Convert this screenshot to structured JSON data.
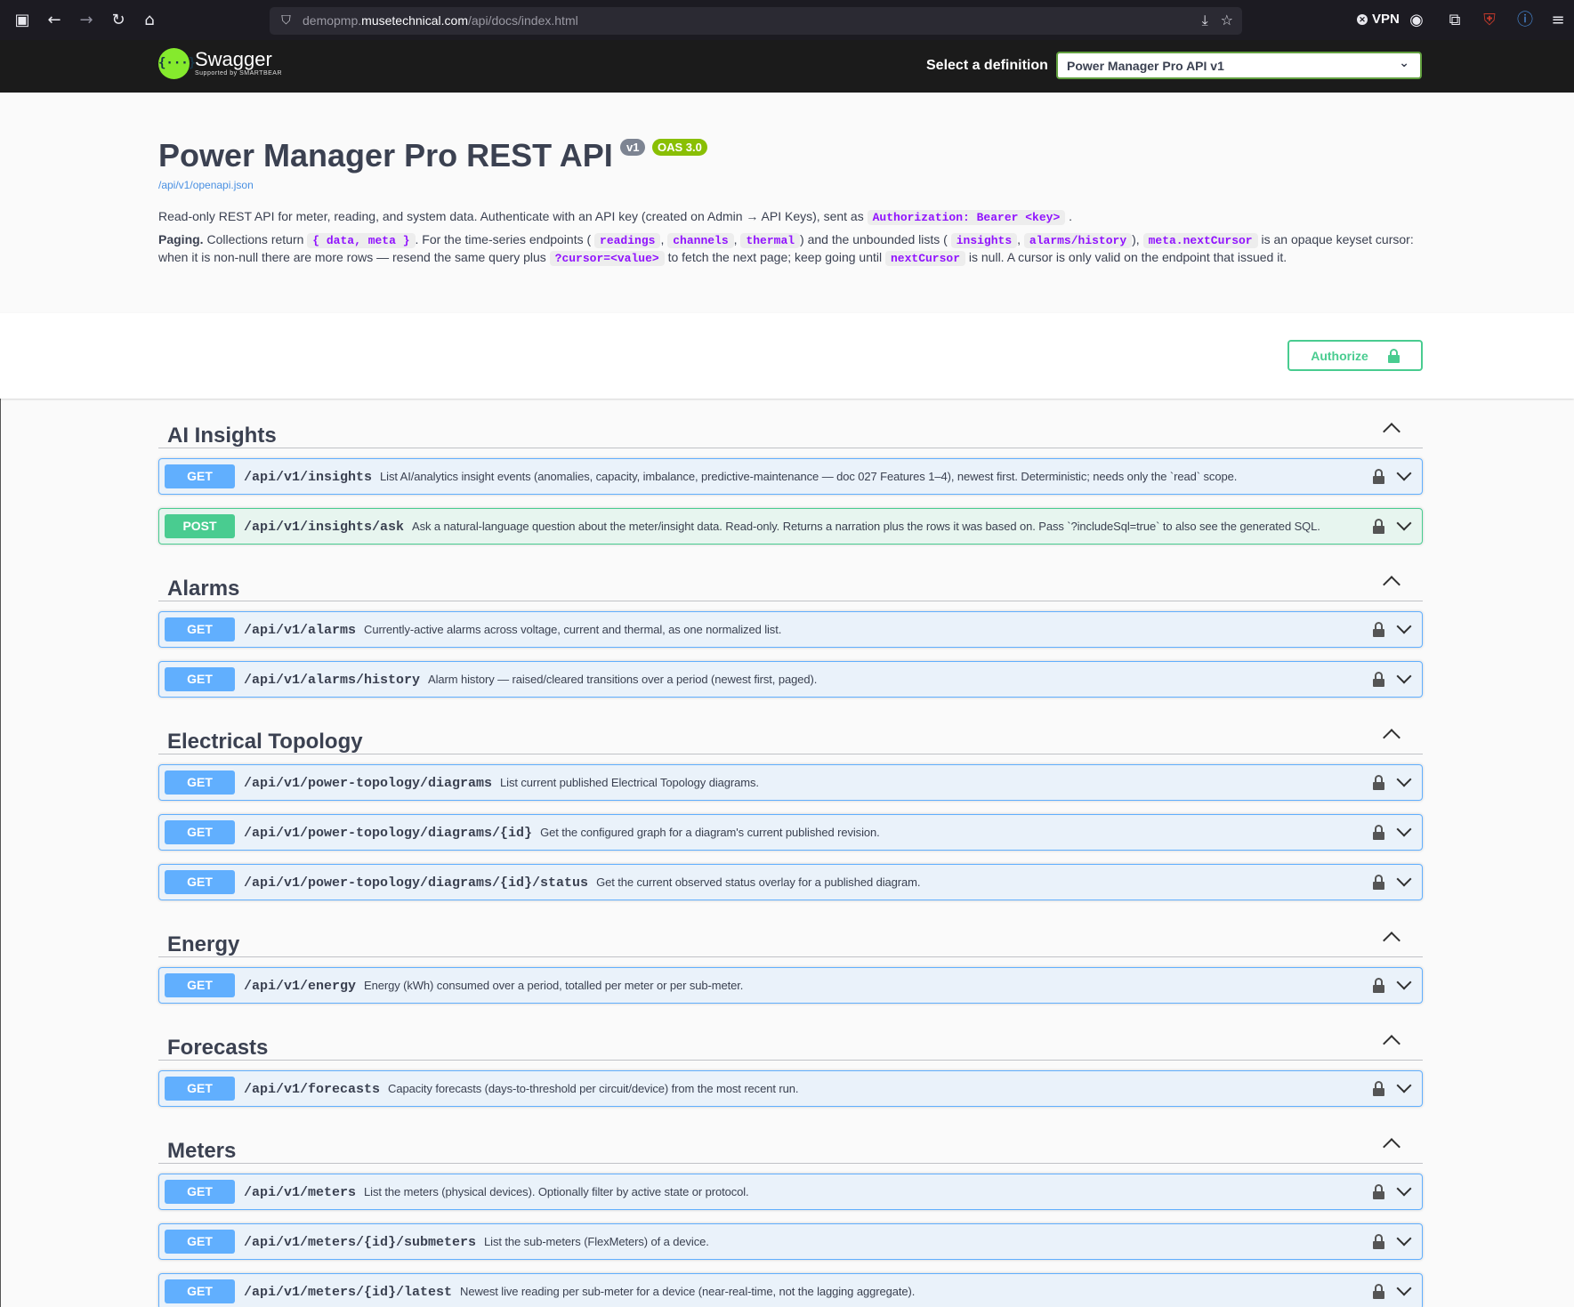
{
  "browser": {
    "url_prefix": "demopmp.",
    "url_host": "musetechnical.com",
    "url_path": "/api/docs/index.html",
    "vpn_label": "VPN"
  },
  "topbar": {
    "logo_main": "Swagger",
    "logo_sub": "Supported by SMARTBEAR",
    "definition_label": "Select a definition",
    "definition_value": "Power Manager Pro API v1"
  },
  "info": {
    "title": "Power Manager Pro REST API",
    "version_badge": "v1",
    "oas_badge": "OAS 3.0",
    "spec_link": "/api/v1/openapi.json",
    "p1_text": "Read-only REST API for meter, reading, and system data. Authenticate with an API key (created on Admin → API Keys), sent as",
    "p1_code": "Authorization: Bearer <key>",
    "p1_end": ".",
    "p2_bold": "Paging.",
    "p2_a": " Collections return",
    "p2_code1": "{ data, meta }",
    "p2_b": ". For the time-series endpoints (",
    "p2_code2": "readings",
    "p2_c": ",",
    "p2_code3": "channels",
    "p2_d": ",",
    "p2_code4": "thermal",
    "p2_e": ") and the unbounded lists (",
    "p2_code5": "insights",
    "p2_f": ",",
    "p2_code6": "alarms/history",
    "p2_g": "),",
    "p2_code7": "meta.nextCursor",
    "p2_h": "is an opaque keyset cursor: when it is non-null there are more rows — resend the same query plus",
    "p2_code8": "?cursor=<value>",
    "p2_i": "to fetch the next page; keep going until",
    "p2_code9": "nextCursor",
    "p2_j": "is null. A cursor is only valid on the endpoint that issued it."
  },
  "authorize_label": "Authorize",
  "tags": [
    {
      "name": "AI Insights",
      "ops": [
        {
          "method": "GET",
          "path": "/api/v1/insights",
          "summary": "List AI/analytics insight events (anomalies, capacity, imbalance, predictive-maintenance — doc 027 Features 1–4), newest first. Deterministic; needs only the `read` scope."
        },
        {
          "method": "POST",
          "path": "/api/v1/insights/ask",
          "summary": "Ask a natural-language question about the meter/insight data. Read-only. Returns a narration plus the rows it was based on. Pass `?includeSql=true` to also see the generated SQL."
        }
      ]
    },
    {
      "name": "Alarms",
      "ops": [
        {
          "method": "GET",
          "path": "/api/v1/alarms",
          "summary": "Currently-active alarms across voltage, current and thermal, as one normalized list."
        },
        {
          "method": "GET",
          "path": "/api/v1/alarms/history",
          "summary": "Alarm history — raised/cleared transitions over a period (newest first, paged)."
        }
      ]
    },
    {
      "name": "Electrical Topology",
      "ops": [
        {
          "method": "GET",
          "path": "/api/v1/power-topology/diagrams",
          "summary": "List current published Electrical Topology diagrams."
        },
        {
          "method": "GET",
          "path": "/api/v1/power-topology/diagrams/{id}",
          "summary": "Get the configured graph for a diagram's current published revision."
        },
        {
          "method": "GET",
          "path": "/api/v1/power-topology/diagrams/{id}/status",
          "summary": "Get the current observed status overlay for a published diagram."
        }
      ]
    },
    {
      "name": "Energy",
      "ops": [
        {
          "method": "GET",
          "path": "/api/v1/energy",
          "summary": "Energy (kWh) consumed over a period, totalled per meter or per sub-meter."
        }
      ]
    },
    {
      "name": "Forecasts",
      "ops": [
        {
          "method": "GET",
          "path": "/api/v1/forecasts",
          "summary": "Capacity forecasts (days-to-threshold per circuit/device) from the most recent run."
        }
      ]
    },
    {
      "name": "Meters",
      "ops": [
        {
          "method": "GET",
          "path": "/api/v1/meters",
          "summary": "List the meters (physical devices). Optionally filter by active state or protocol."
        },
        {
          "method": "GET",
          "path": "/api/v1/meters/{id}/submeters",
          "summary": "List the sub-meters (FlexMeters) of a device."
        },
        {
          "method": "GET",
          "path": "/api/v1/meters/{id}/latest",
          "summary": "Newest live reading per sub-meter for a device (near-real-time, not the lagging aggregate)."
        }
      ]
    }
  ]
}
